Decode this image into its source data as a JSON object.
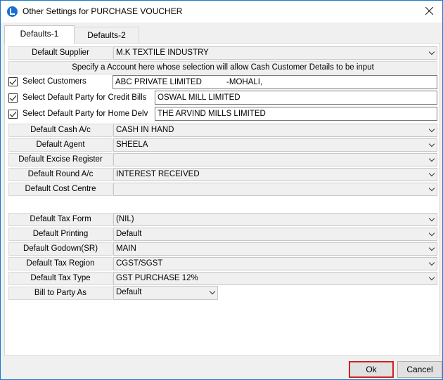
{
  "window": {
    "title": "Other Settings for PURCHASE VOUCHER"
  },
  "tabs": [
    {
      "label": "Defaults-1",
      "active": true
    },
    {
      "label": "Defaults-2",
      "active": false
    }
  ],
  "supplier": {
    "label": "Default Supplier",
    "value": "M.K TEXTILE INDUSTRY"
  },
  "info_text": "Specify a Account here whose selection will allow Cash Customer Details to be input",
  "checks": [
    {
      "label": "Select Customers",
      "checked": true,
      "value": "ABC PRIVATE LIMITED           -MOHALI,"
    },
    {
      "label": "Select Default Party for Credit Bills",
      "checked": true,
      "value": "OSWAL MILL LIMITED"
    },
    {
      "label": "Select Default Party for Home Delv",
      "checked": true,
      "value": "THE ARVIND MILLS LIMITED"
    }
  ],
  "group1": [
    {
      "label": "Default Cash A/c",
      "value": "CASH IN HAND"
    },
    {
      "label": "Default Agent",
      "value": "SHEELA"
    },
    {
      "label": "Default Excise Register",
      "value": ""
    },
    {
      "label": "Default Round A/c",
      "value": "INTEREST RECEIVED"
    },
    {
      "label": "Default Cost Centre",
      "value": ""
    }
  ],
  "group2": [
    {
      "label": "Default Tax Form",
      "value": "(NIL)"
    },
    {
      "label": "Default Printing",
      "value": "Default"
    },
    {
      "label": "Default Godown(SR)",
      "value": "MAIN"
    },
    {
      "label": "Default Tax Region",
      "value": "CGST/SGST"
    },
    {
      "label": "Default Tax Type",
      "value": "GST PURCHASE 12%"
    },
    {
      "label": "Bill to Party As",
      "value": "Default"
    }
  ],
  "buttons": {
    "ok": "Ok",
    "cancel": "Cancel"
  },
  "colors": {
    "ok_highlight": "#d52020",
    "window_border": "#1979ca"
  }
}
